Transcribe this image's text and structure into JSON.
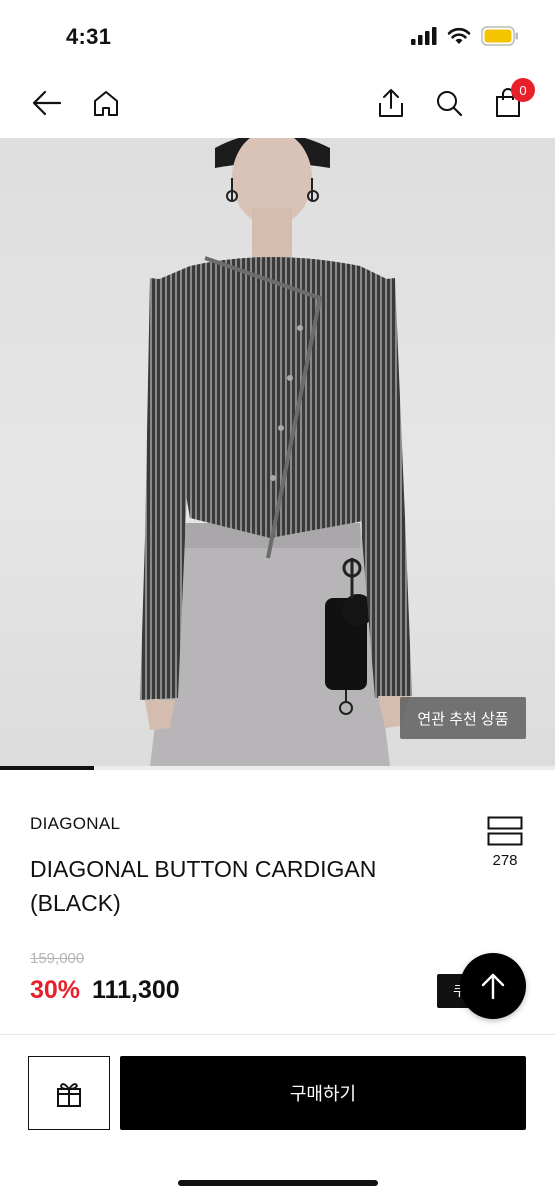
{
  "status_bar": {
    "time": "4:31",
    "icons": [
      "signal-icon",
      "wifi-icon",
      "battery-icon"
    ],
    "battery_color": "#f5c400"
  },
  "nav": {
    "icons": [
      "back-arrow-icon",
      "home-icon",
      "share-icon",
      "search-icon",
      "shopping-bag-icon"
    ],
    "cart_count": "0"
  },
  "image": {
    "related_label": "연관 추천 상품",
    "progress": 0.17
  },
  "product": {
    "brand": "DIAGONAL",
    "name": "DIAGONAL BUTTON CARDIGAN (BLACK)",
    "like_count": "278",
    "original_price": "159,000",
    "discount": "30%",
    "price": "111,300",
    "coupon_label": "쿠"
  },
  "bottom": {
    "buy_label": "구매하기"
  },
  "colors": {
    "accent_red": "#e8202a",
    "primary": "#000000"
  }
}
